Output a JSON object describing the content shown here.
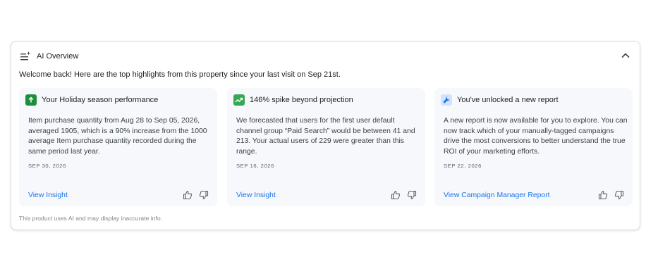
{
  "panel": {
    "title": "AI Overview",
    "welcome": "Welcome back! Here are the top highlights from this property since your last visit on Sep 21st.",
    "disclaimer": "This product uses AI and may display inaccurate info."
  },
  "colors": {
    "link": "#1a73e8",
    "badge_green": "#1e8e3e",
    "badge_chart": "#34a853",
    "badge_blue": "#d2e3fc"
  },
  "cards": [
    {
      "icon": "arrow-up-icon",
      "title": "Your Holiday season performance",
      "body": "Item purchase quantity from Aug 28 to Sep 05, 2026, averaged 1905, which is a 90% increase from the 1000 average Item purchase quantity recorded during the same period last year.",
      "date": "SEP 30, 2026",
      "link": "View Insight"
    },
    {
      "icon": "trending-up-icon",
      "title": "146% spike beyond projection",
      "body": "We forecasted that users for the first user default channel group “Paid Search” would be between 41 and 213. Your actual users of 229 were greater than this range.",
      "date": "SEP 16, 2026",
      "link": "View Insight"
    },
    {
      "icon": "wrench-icon",
      "title": "You've unlocked a new report",
      "body": "A new report is now available for you to explore. You can now track which of your manually-tagged campaigns drive the most conversions to better understand the true ROI of your marketing efforts.",
      "date": "SEP 22, 2026",
      "link": "View Campaign Manager Report"
    }
  ]
}
